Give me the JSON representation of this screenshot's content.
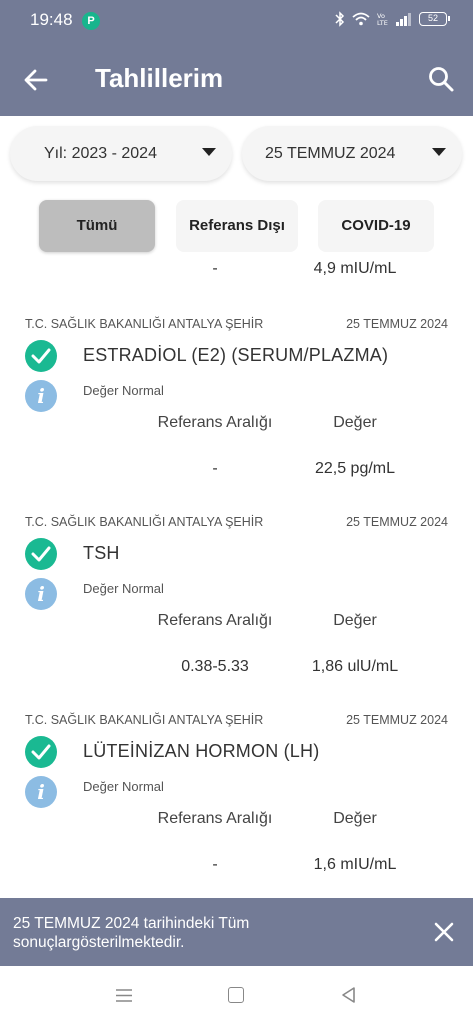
{
  "status_bar": {
    "time": "19:48",
    "app_icon": "P",
    "battery": "52"
  },
  "app_bar": {
    "title": "Tahlillerim",
    "icons": [
      "back-arrow-icon",
      "search-icon"
    ]
  },
  "filters": {
    "year_select": "Yıl: 2023 - 2024",
    "date_select": "25 TEMMUZ 2024",
    "chips": [
      {
        "label": "Tümü",
        "selected": true
      },
      {
        "label": "Referans Dışı",
        "selected": false
      },
      {
        "label": "COVID-19",
        "selected": false
      }
    ]
  },
  "results": {
    "partial_top": {
      "reference": "-",
      "value": "4,9 mIU/mL"
    },
    "columns": {
      "reference": "Referans Aralığı",
      "value": "Değer"
    },
    "items": [
      {
        "institution": "T.C. SAĞLIK BAKANLIĞI ANTALYA ŞEHİR",
        "date": "25 TEMMUZ 2024",
        "test": "ESTRADİOL (E2) (SERUM/PLAZMA)",
        "status": "Değer Normal",
        "reference": "-",
        "value": "22,5 pg/mL"
      },
      {
        "institution": "T.C. SAĞLIK BAKANLIĞI ANTALYA ŞEHİR",
        "date": "25 TEMMUZ 2024",
        "test": "TSH",
        "status": "Değer Normal",
        "reference": "0.38-5.33",
        "value": "1,86 ulU/mL"
      },
      {
        "institution": "T.C. SAĞLIK BAKANLIĞI ANTALYA ŞEHİR",
        "date": "25 TEMMUZ 2024",
        "test": "LÜTEİNİZAN HORMON (LH)",
        "status": "Değer Normal",
        "reference": "-",
        "value": "1,6 mIU/mL"
      }
    ]
  },
  "snackbar": {
    "message": "25 TEMMUZ 2024 tarihindeki Tüm sonuçlargösterilmektedir."
  },
  "colors": {
    "header": "#737b96",
    "success": "#1ab992",
    "info": "#8cbce3",
    "chip_selected": "#bdbdbd"
  }
}
